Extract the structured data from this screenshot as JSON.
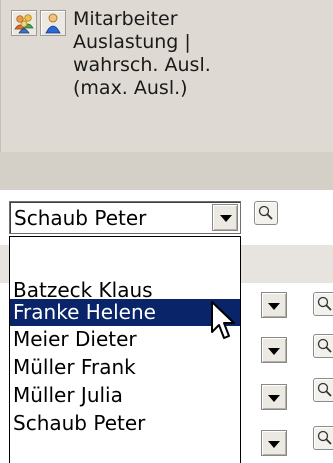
{
  "header": {
    "title": "Mitarbeiter\nAuslastung |\nwahrsch. Ausl.\n(max. Ausl.)",
    "icons": [
      "group-icon",
      "person-icon"
    ]
  },
  "filter": {
    "selected": "Schaub Peter"
  },
  "dropdown": {
    "options": [
      "",
      "Batzeck Klaus",
      "Franke Helene",
      "Meier Dieter",
      "Müller Frank",
      "Müller Julia",
      "Schaub Peter"
    ],
    "highlighted": "Franke Helene"
  },
  "colors": {
    "header_bg": "#dedad3",
    "selection_bg": "#0a246a"
  }
}
